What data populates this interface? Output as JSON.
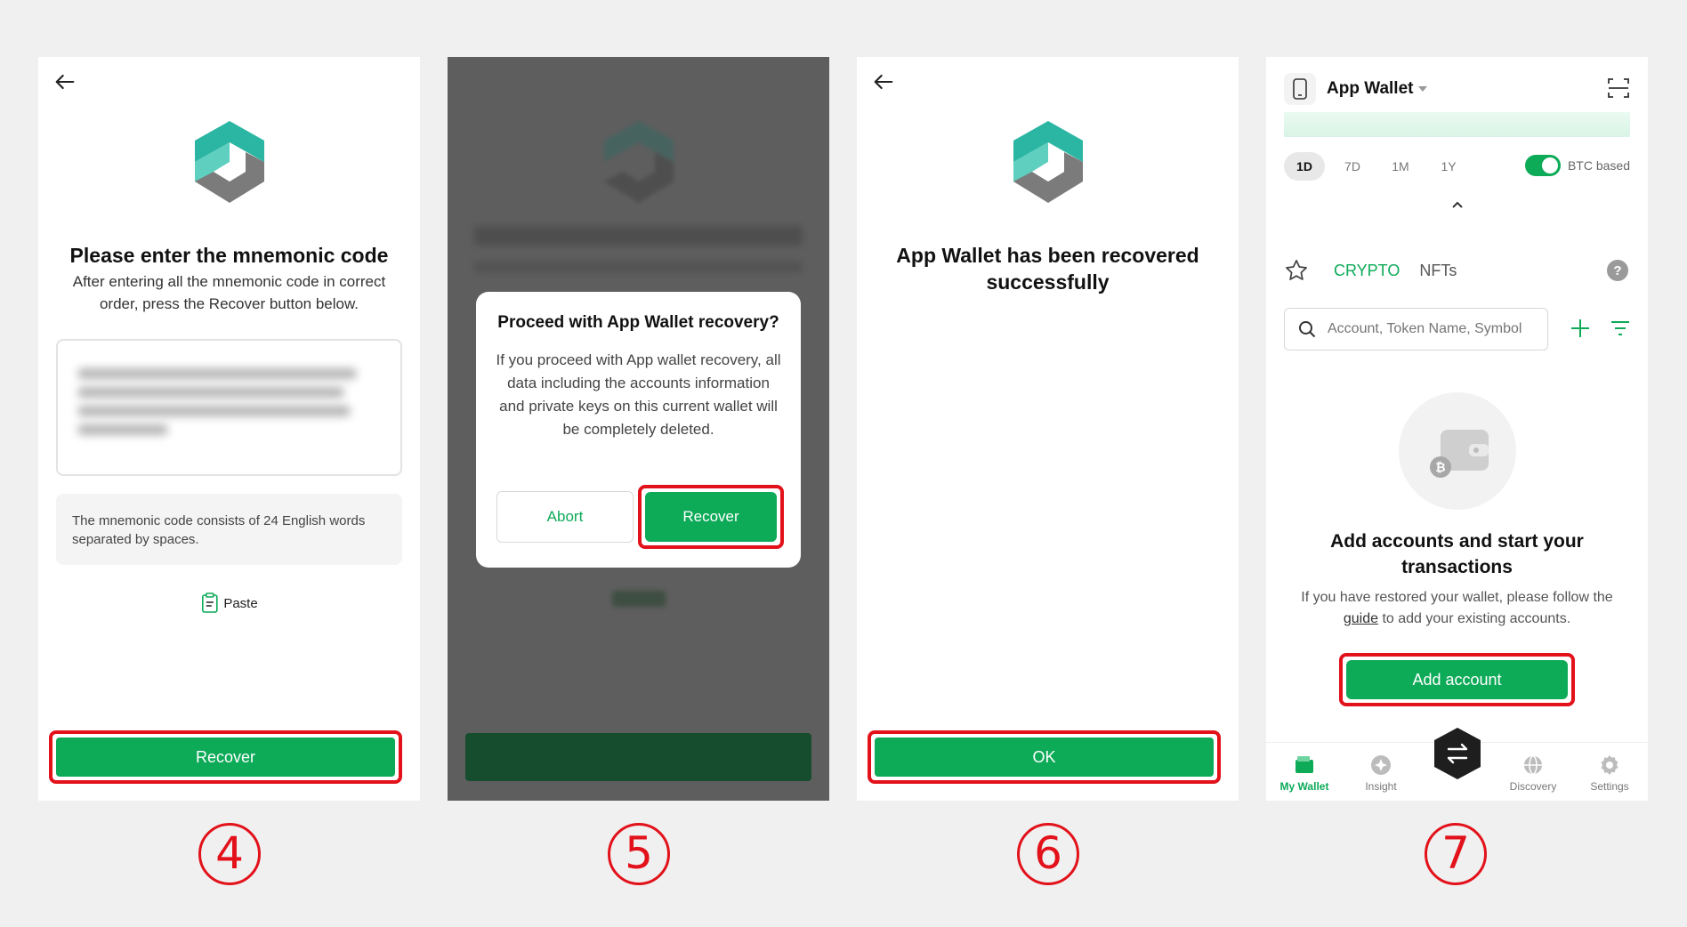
{
  "steps": [
    "4",
    "5",
    "6",
    "7"
  ],
  "panel4": {
    "title": "Please enter the mnemonic code",
    "subtitle": "After entering all the mnemonic code in correct order, press the Recover button below.",
    "hint": "The mnemonic code consists of 24 English words separated by spaces.",
    "paste_label": "Paste",
    "recover_label": "Recover"
  },
  "panel5": {
    "dialog_title": "Proceed with App Wallet recovery?",
    "dialog_body": "If you proceed with App wallet recovery, all data including the accounts information and private keys on this current wallet will be completely deleted.",
    "abort_label": "Abort",
    "recover_label": "Recover"
  },
  "panel6": {
    "title": "App Wallet has been recovered successfully",
    "ok_label": "OK"
  },
  "panel7": {
    "wallet_name": "App Wallet",
    "periods": [
      "1D",
      "7D",
      "1M",
      "1Y"
    ],
    "active_period": "1D",
    "btc_based_label": "BTC based",
    "btc_based_on": true,
    "tabs": [
      "CRYPTO",
      "NFTs"
    ],
    "active_tab": "CRYPTO",
    "search_placeholder": "Account, Token Name, Symbol",
    "empty_title": "Add accounts and start your transactions",
    "empty_desc_before": "If you have restored your wallet, please follow the ",
    "empty_desc_link": "guide",
    "empty_desc_after": " to add your existing accounts.",
    "add_account_label": "Add account",
    "tabbar": [
      "My Wallet",
      "Insight",
      "Discovery",
      "Settings"
    ],
    "active_tabbar": "My Wallet"
  },
  "colors": {
    "accent_green": "#0daa58",
    "highlight_red": "#e2111a",
    "logo_teal": "#2bb5a3",
    "logo_gray": "#7b7b7b"
  },
  "icons": [
    "back-arrow-icon",
    "logo-icon",
    "clipboard-icon",
    "phone-icon",
    "scan-icon",
    "chevron-up-icon",
    "star-icon",
    "help-icon",
    "search-icon",
    "plus-icon",
    "filter-icon",
    "wallet-icon",
    "insight-icon",
    "swap-icon",
    "globe-icon",
    "gear-icon"
  ]
}
